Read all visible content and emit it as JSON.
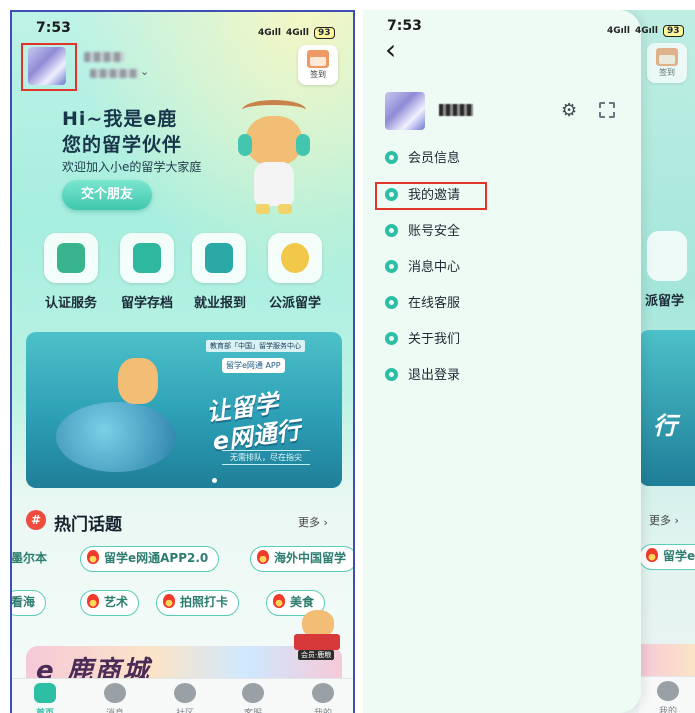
{
  "status_bar": {
    "time": "7:53",
    "signal_left": "4G",
    "signal_right": "4G",
    "battery": "93"
  },
  "home": {
    "checkin_label": "签到",
    "hero": {
      "title_line1": "Hi~我是e鹿",
      "title_line2": "您的留学伙伴",
      "subtitle": "欢迎加入小e的留学大家庭",
      "button": "交个朋友"
    },
    "services": [
      {
        "label": "认证服务",
        "color": "#38b58f"
      },
      {
        "label": "留学存档",
        "color": "#2eb8a0"
      },
      {
        "label": "就业报到",
        "color": "#2aa9a6"
      },
      {
        "label": "公派留学",
        "color": "#f2c84b"
      }
    ],
    "banner": {
      "org": "教育部「中国」留学服务中心",
      "app_badge": "留学e网通 APP",
      "slogan_line1": "让留学",
      "slogan_line2": "e网通行",
      "tagline": "无需排队，尽在指尖"
    },
    "topics": {
      "title": "热门话题",
      "more": "更多 ›",
      "row1": [
        "墨尔本",
        "留学e网通APP2.0",
        "海外中国留学"
      ],
      "row2": [
        "看海",
        "艺术",
        "拍照打卡",
        "美食"
      ]
    },
    "mall": {
      "text": "e 鹿商城",
      "sticker": "会员·鹿粮"
    },
    "tabs": [
      {
        "label": "首页",
        "active": true
      },
      {
        "label": "消息",
        "active": false
      },
      {
        "label": "社区",
        "active": false
      },
      {
        "label": "客服",
        "active": false
      },
      {
        "label": "我的",
        "active": false
      }
    ]
  },
  "drawer": {
    "back": "‹",
    "menu": [
      {
        "label": "会员信息",
        "highlighted": false
      },
      {
        "label": "我的邀请",
        "highlighted": true
      },
      {
        "label": "账号安全",
        "highlighted": false
      },
      {
        "label": "消息中心",
        "highlighted": false
      },
      {
        "label": "在线客服",
        "highlighted": false
      },
      {
        "label": "关于我们",
        "highlighted": false
      },
      {
        "label": "退出登录",
        "highlighted": false
      }
    ],
    "peek": {
      "services_tail": "派留学",
      "banner_tail": "行",
      "more": "更多 ›",
      "chip_tail": "留学e",
      "checkin": "签到",
      "tab": "我的"
    }
  },
  "colors": {
    "accent": "#2dbfa4",
    "highlight_box": "#e0352b",
    "drawer_bg": "#eefbf5"
  }
}
